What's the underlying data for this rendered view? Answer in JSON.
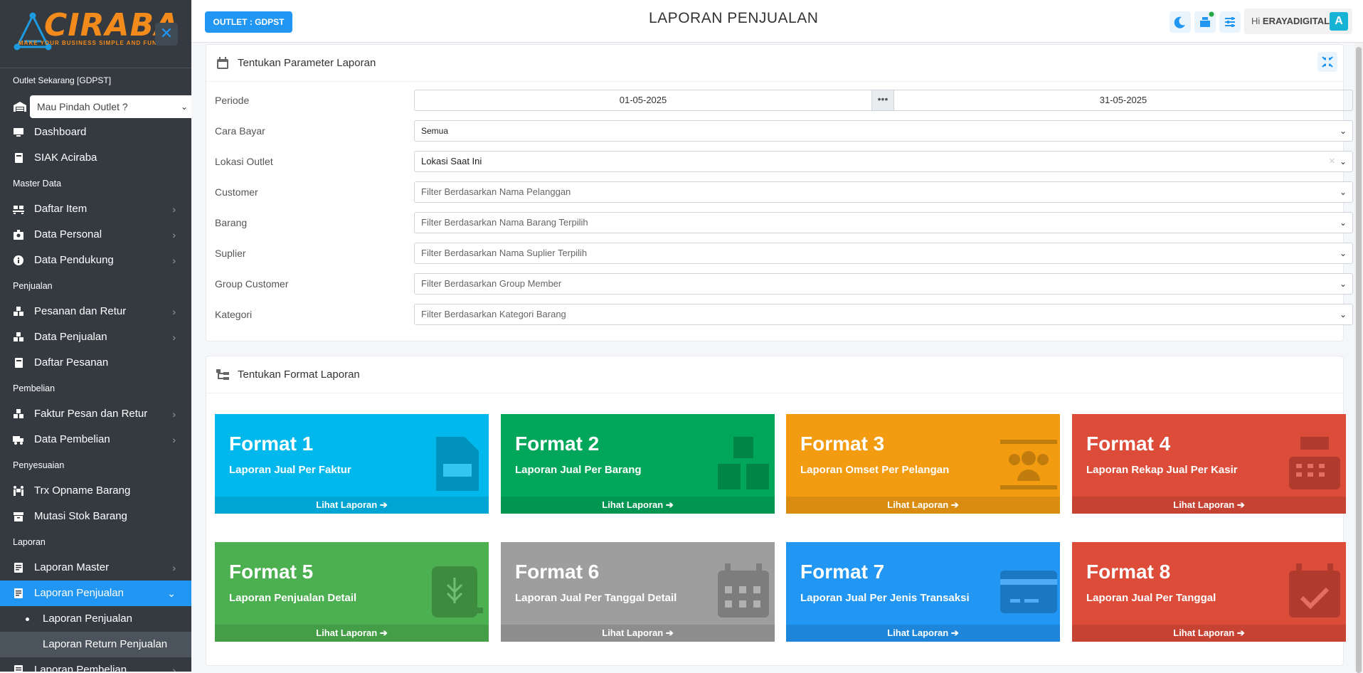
{
  "brand": {
    "name": "CIRABA",
    "tagline": "MAKE YOUR BUSINESS SIMPLE AND FUN"
  },
  "sidebar": {
    "outlet_label": "Outlet Sekarang [GDPST]",
    "outlet_select": "Mau Pindah Outlet ?",
    "items": [
      {
        "type": "item",
        "label": "Dashboard",
        "icon": "monitor-icon"
      },
      {
        "type": "item",
        "label": "SIAK Aciraba",
        "icon": "book-icon"
      },
      {
        "type": "header",
        "label": "Master Data"
      },
      {
        "type": "item",
        "label": "Daftar Item",
        "icon": "pallet-icon",
        "arrow": true
      },
      {
        "type": "item",
        "label": "Data Personal",
        "icon": "id-badge-icon",
        "arrow": true
      },
      {
        "type": "item",
        "label": "Data Pendukung",
        "icon": "info-circle-icon",
        "arrow": true
      },
      {
        "type": "header",
        "label": "Penjualan"
      },
      {
        "type": "item",
        "label": "Pesanan dan Retur",
        "icon": "boxes-icon",
        "arrow": true
      },
      {
        "type": "item",
        "label": "Data Penjualan",
        "icon": "boxes-icon",
        "arrow": true
      },
      {
        "type": "item",
        "label": "Daftar Pesanan",
        "icon": "book-icon"
      },
      {
        "type": "header",
        "label": "Pembelian"
      },
      {
        "type": "item",
        "label": "Faktur Pesan dan Retur",
        "icon": "boxes-icon",
        "arrow": true
      },
      {
        "type": "item",
        "label": "Data Pembelian",
        "icon": "truck-icon",
        "arrow": true
      },
      {
        "type": "header",
        "label": "Penyesuaian"
      },
      {
        "type": "item",
        "label": "Trx Opname Barang",
        "icon": "people-carry-icon"
      },
      {
        "type": "item",
        "label": "Mutasi Stok Barang",
        "icon": "archive-icon"
      },
      {
        "type": "header",
        "label": "Laporan"
      },
      {
        "type": "item",
        "label": "Laporan Master",
        "icon": "report-icon",
        "arrow": true
      },
      {
        "type": "item",
        "label": "Laporan Penjualan",
        "icon": "report-icon",
        "arrow": true,
        "active": true
      },
      {
        "type": "sub",
        "label": "Laporan Penjualan",
        "active": true
      },
      {
        "type": "sub",
        "label": "Laporan Return Penjualan",
        "hl": true
      },
      {
        "type": "item",
        "label": "Laporan Pembelian",
        "icon": "report-icon",
        "arrow": true
      }
    ]
  },
  "topbar": {
    "outlet_button": "OUTLET : GDPST",
    "title": "LAPORAN PENJUALAN",
    "greeting": "Hi",
    "username": "ERAYADIGITAL",
    "avatar_letter": "A"
  },
  "params": {
    "title": "Tentukan Parameter Laporan",
    "periode_label": "Periode",
    "date_from": "01-05-2025",
    "date_sep": "•••",
    "date_to": "31-05-2025",
    "fields": [
      {
        "label": "Cara Bayar",
        "value": "Semua",
        "dark": true,
        "small": true
      },
      {
        "label": "Lokasi Outlet",
        "value": "Lokasi Saat Ini",
        "dark": true,
        "clear": true
      },
      {
        "label": "Customer",
        "value": "Filter Berdasarkan Nama Pelanggan"
      },
      {
        "label": "Barang",
        "value": "Filter Berdasarkan Nama Barang Terpilih"
      },
      {
        "label": "Suplier",
        "value": "Filter Berdasarkan Nama Suplier Terpilih"
      },
      {
        "label": "Group Customer",
        "value": "Filter Berdasarkan Group Member"
      },
      {
        "label": "Kategori",
        "value": "Filter Berdasarkan Kategori Barang"
      }
    ]
  },
  "formats": {
    "title": "Tentukan Format Laporan",
    "link_label": "Lihat Laporan",
    "tiles": [
      {
        "title": "Format 1",
        "subtitle": "Laporan Jual Per Faktur",
        "color": "#00b8ec",
        "icon": "file-invoice-icon"
      },
      {
        "title": "Format 2",
        "subtitle": "Laporan Jual Per Barang",
        "color": "#00a65a",
        "icon": "boxes-icon"
      },
      {
        "title": "Format 3",
        "subtitle": "Laporan Omset Per Pelangan",
        "color": "#f39c12",
        "icon": "users-icon"
      },
      {
        "title": "Format 4",
        "subtitle": "Laporan Rekap Jual Per Kasir",
        "color": "#dd4b39",
        "icon": "cash-register-icon"
      },
      {
        "title": "Format 5",
        "subtitle": "Laporan Penjualan Detail",
        "color": "#4caf50",
        "icon": "book-leaf-icon"
      },
      {
        "title": "Format 6",
        "subtitle": "Laporan Jual Per Tanggal Detail",
        "color": "#9e9e9e",
        "icon": "calendar-icon"
      },
      {
        "title": "Format 7",
        "subtitle": "Laporan Jual Per Jenis Transaksi",
        "color": "#2196f3",
        "icon": "credit-card-icon"
      },
      {
        "title": "Format 8",
        "subtitle": "Laporan Jual Per Tanggal",
        "color": "#dd4b39",
        "icon": "calendar-check-icon"
      }
    ]
  }
}
